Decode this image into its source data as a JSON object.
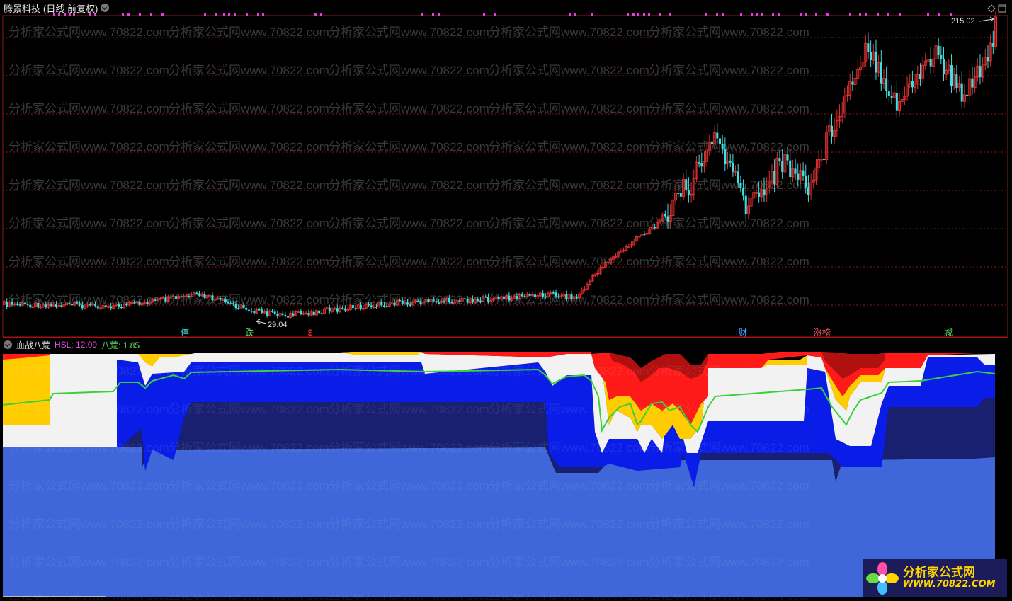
{
  "header": {
    "stock_name": "腾景科技",
    "period": "(日线 前复权)"
  },
  "indicator": {
    "name": "血战八荒",
    "hsl_label": "HSL: 12.09",
    "bh_label": "八荒: 1.85"
  },
  "watermark": "分析家公式网www.70822.com",
  "logo": {
    "line1": "分析家公式网",
    "line2": "WWW.70822.COM"
  },
  "colors": {
    "up": "#e03030",
    "down": "#40e0e0",
    "grid": "#8b1a1a",
    "ind_white": "#f2f2f2",
    "ind_yellow": "#ffcc00",
    "ind_red": "#ff1a1a",
    "ind_darkred": "#b01010",
    "ind_blue": "#0a1de8",
    "ind_navy": "#1a2070",
    "ind_light": "#3f67d9",
    "ind_line": "#39d039"
  },
  "chart_data": [
    {
      "type": "candlestick",
      "annotations": {
        "high_label": "215.02",
        "low_label": "29.04"
      },
      "markers": [
        {
          "label": "停",
          "color": "#40e0e0"
        },
        {
          "label": "跌",
          "color": "#66ee66"
        },
        {
          "label": "$",
          "color": "#ff3030"
        },
        {
          "label": "财",
          "color": "#40a0ff"
        },
        {
          "label": "涨榜",
          "color": "#ff6060"
        },
        {
          "label": "减",
          "color": "#66ee66"
        }
      ],
      "price_range": [
        29.04,
        215.02
      ]
    },
    {
      "type": "area",
      "title": "血战八荒",
      "series": [
        {
          "name": "HSL",
          "last": 12.09
        },
        {
          "name": "八荒",
          "last": 1.85
        }
      ]
    }
  ]
}
